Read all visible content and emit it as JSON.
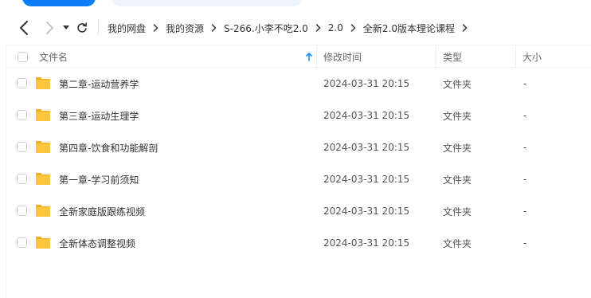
{
  "colors": {
    "accent": "#0b7ef5",
    "folder": "#ffc53d",
    "folder_dark": "#f5b11c"
  },
  "nav": {
    "back_icon": "chevron-left-icon",
    "forward_icon": "chevron-right-icon",
    "dropdown_icon": "caret-down-icon",
    "refresh_icon": "refresh-icon"
  },
  "breadcrumb": [
    {
      "label": "我的网盘"
    },
    {
      "label": "我的资源"
    },
    {
      "label": "S-266.小李不吃2.0"
    },
    {
      "label": "2.0"
    },
    {
      "label": "全新2.0版本理论课程"
    }
  ],
  "table": {
    "columns": {
      "name": "文件名",
      "mtime": "修改时间",
      "type": "类型",
      "size": "大小"
    },
    "sort_icon": "sort-up-arrow-icon",
    "rows": [
      {
        "name": "第二章-运动营养学",
        "mtime": "2024-03-31 20:15",
        "type": "文件夹",
        "size": "-"
      },
      {
        "name": "第三章-运动生理学",
        "mtime": "2024-03-31 20:15",
        "type": "文件夹",
        "size": "-"
      },
      {
        "name": "第四章-饮食和功能解剖",
        "mtime": "2024-03-31 20:15",
        "type": "文件夹",
        "size": "-"
      },
      {
        "name": "第一章-学习前须知",
        "mtime": "2024-03-31 20:15",
        "type": "文件夹",
        "size": "-"
      },
      {
        "name": "全新家庭版跟练视频",
        "mtime": "2024-03-31 20:15",
        "type": "文件夹",
        "size": "-"
      },
      {
        "name": "全新体态调整视频",
        "mtime": "2024-03-31 20:15",
        "type": "文件夹",
        "size": "-"
      }
    ]
  }
}
